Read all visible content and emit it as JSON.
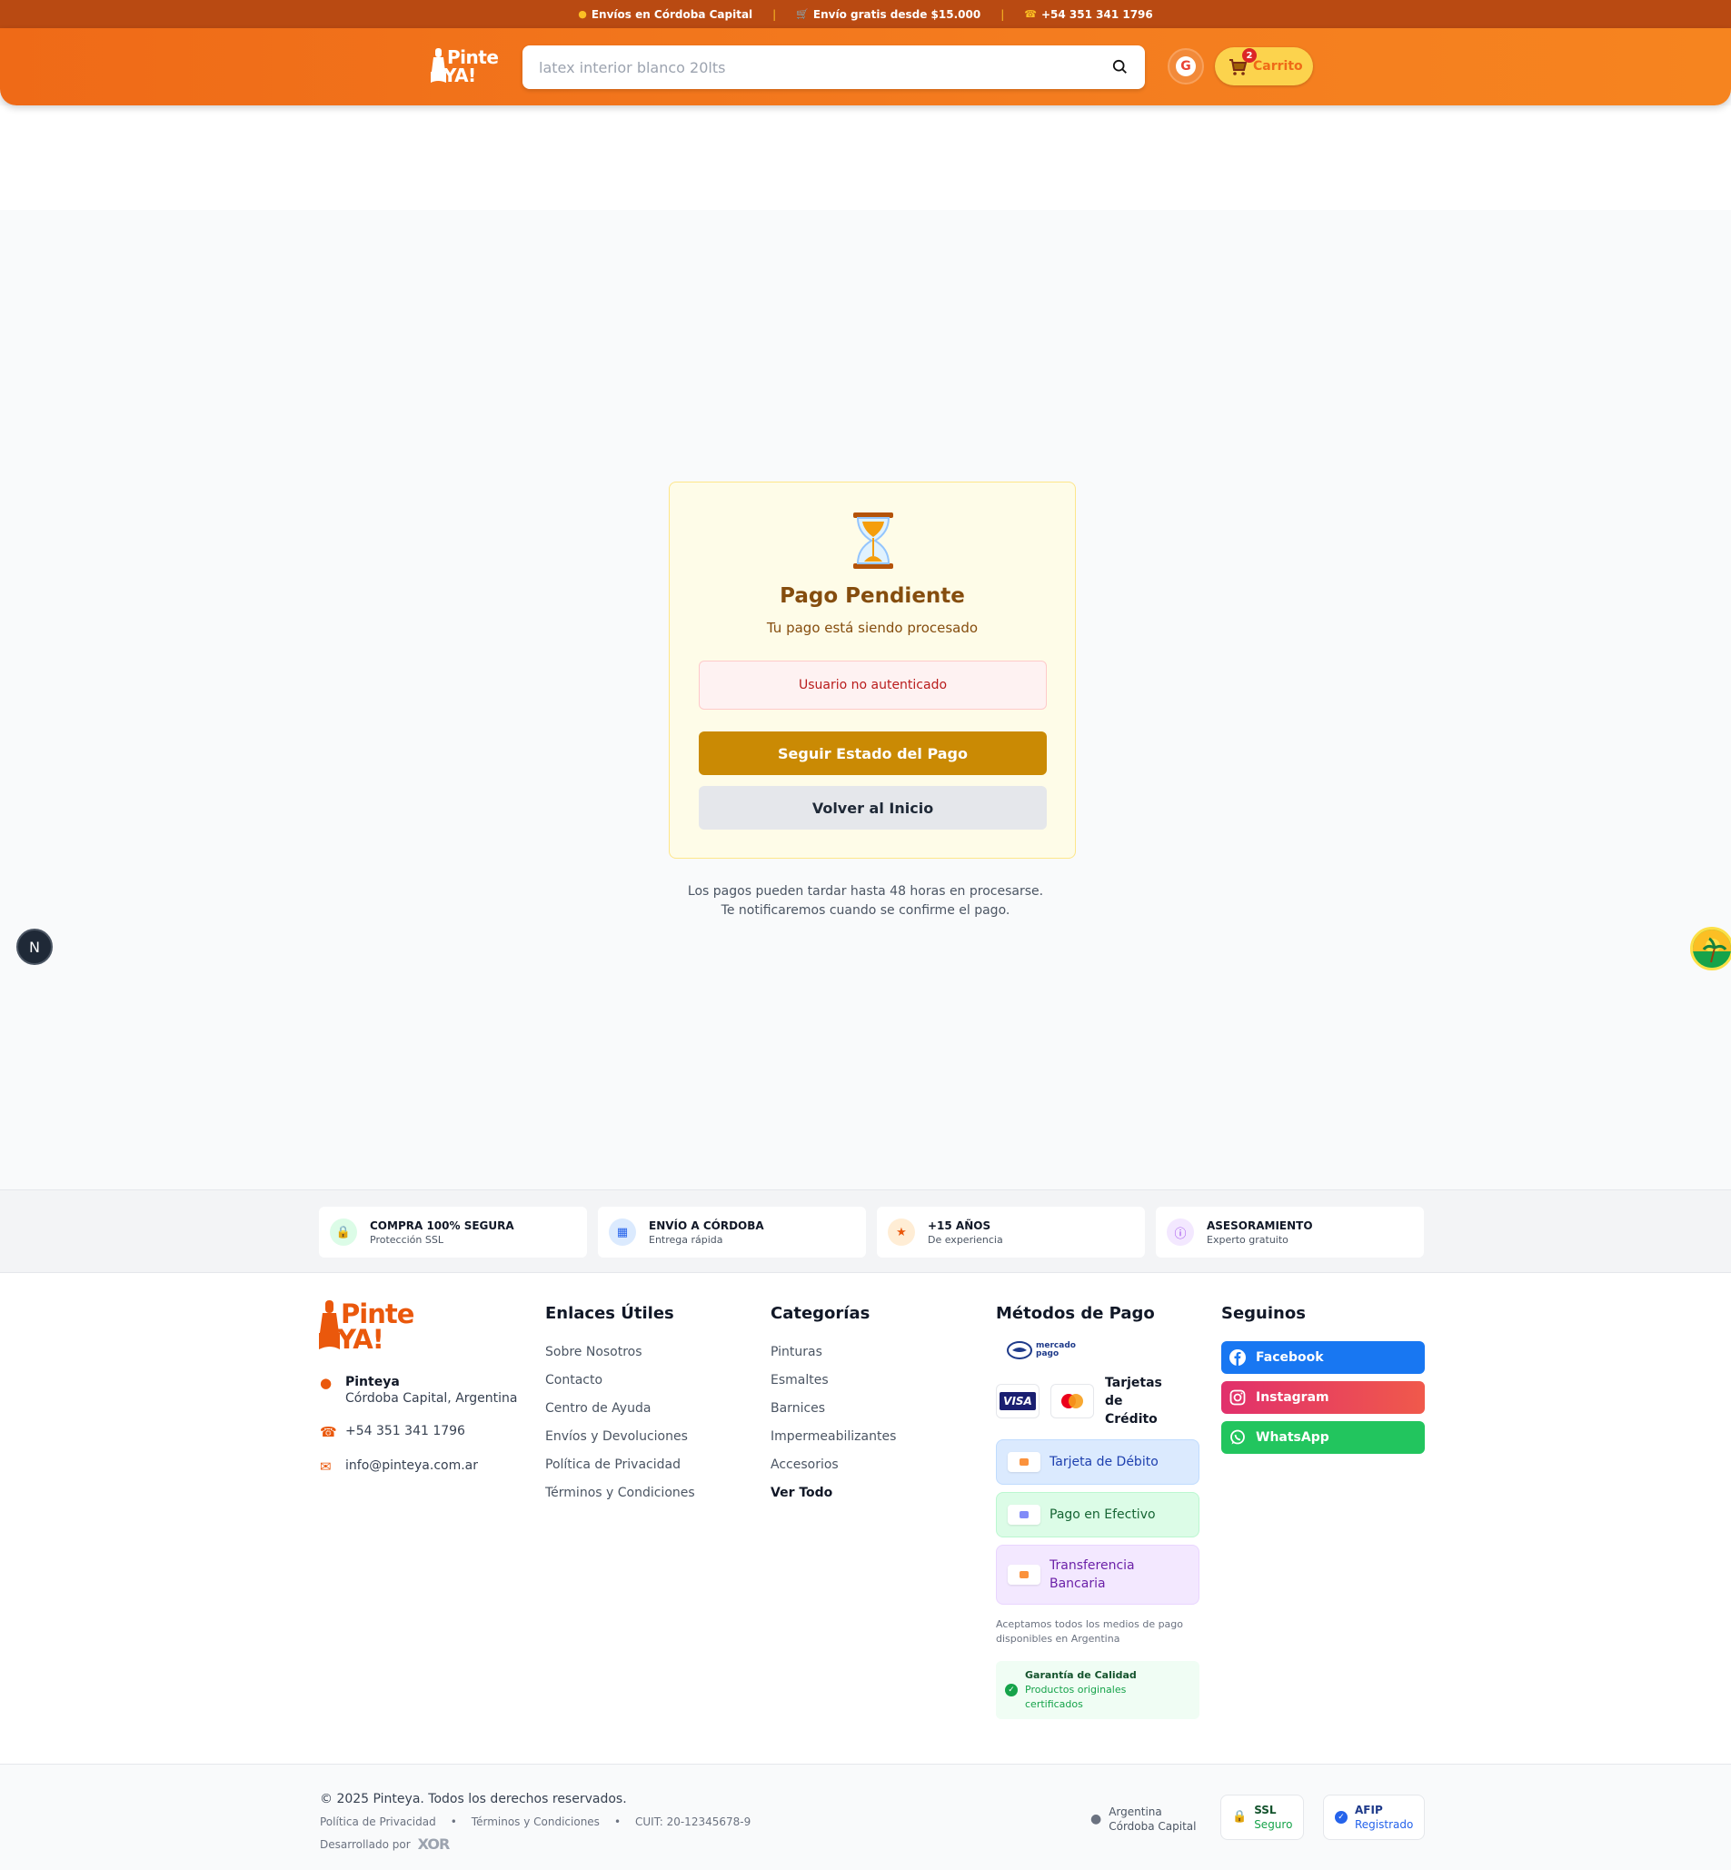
{
  "topbar": {
    "shipping": "Envíos en Córdoba Capital",
    "free_shipping": "Envío gratis desde $15.000",
    "phone": "+54 351 341 1796",
    "separator": "|"
  },
  "header": {
    "logo_line1": "Pinte",
    "logo_line2": "YA!",
    "search_placeholder": "latex interior blanco 20lts",
    "cart_label": "Carrito",
    "cart_count": "2"
  },
  "payment_status": {
    "title": "Pago Pendiente",
    "subtitle": "Tu pago está siendo procesado",
    "error": "Usuario no autenticado",
    "primary_button": "Seguir Estado del Pago",
    "secondary_button": "Volver al Inicio",
    "note_line1": "Los pagos pueden tardar hasta 48 horas en procesarse.",
    "note_line2": "Te notificaremos cuando se confirme el pago."
  },
  "floating": {
    "dev_badge": "N"
  },
  "trust": [
    {
      "title": "COMPRA 100% SEGURA",
      "subtitle": "Protección SSL",
      "icon": "lock-icon",
      "color": "#16a34a",
      "bg": "#dcfce7"
    },
    {
      "title": "ENVÍO A CÓRDOBA",
      "subtitle": "Entrega rápida",
      "icon": "truck-icon",
      "color": "#2563eb",
      "bg": "#dbeafe"
    },
    {
      "title": "+15 AÑOS",
      "subtitle": "De experiencia",
      "icon": "star-icon",
      "color": "#ea580c",
      "bg": "#ffedd5"
    },
    {
      "title": "ASESORAMIENTO",
      "subtitle": "Experto gratuito",
      "icon": "info-icon",
      "color": "#9333ea",
      "bg": "#f3e8ff"
    }
  ],
  "footer": {
    "logo_line1": "Pinte",
    "logo_line2": "YA!",
    "company": "Pinteya",
    "address": "Córdoba Capital, Argentina",
    "phone": "+54 351 341 1796",
    "email": "info@pinteya.com.ar",
    "useful_links": {
      "title": "Enlaces Útiles",
      "items": [
        "Sobre Nosotros",
        "Contacto",
        "Centro de Ayuda",
        "Envíos y Devoluciones",
        "Política de Privacidad",
        "Términos y Condiciones"
      ]
    },
    "categories": {
      "title": "Categorías",
      "items": [
        "Pinturas",
        "Esmaltes",
        "Barnices",
        "Impermeabilizantes",
        "Accesorios"
      ],
      "view_all": "Ver Todo"
    },
    "payment": {
      "title": "Métodos de Pago",
      "mercadopago_l1": "mercado",
      "mercadopago_l2": "pago",
      "visa": "VISA",
      "credit_cards": "Tarjetas de Crédito",
      "debit": "Tarjeta de Débito",
      "cash": "Pago en Efectivo",
      "transfer": "Transferencia Bancaria",
      "accept_note": "Aceptamos todos los medios de pago disponibles en Argentina",
      "guarantee_title": "Garantía de Calidad",
      "guarantee_text": "Productos originales certificados"
    },
    "social": {
      "title": "Seguinos",
      "facebook": "Facebook",
      "instagram": "Instagram",
      "whatsapp": "WhatsApp"
    }
  },
  "bottom": {
    "copyright": "© 2025 Pinteya. Todos los derechos reservados.",
    "privacy": "Política de Privacidad",
    "terms": "Términos y Condiciones",
    "cuit": "CUIT: 20-12345678-9",
    "bullet": "•",
    "developed_by": "Desarrollado por",
    "dev_logo": "XOR",
    "location_l1": "Argentina",
    "location_l2": "Córdoba Capital",
    "ssl_title": "SSL",
    "ssl_sub": "Seguro",
    "afip_title": "AFIP",
    "afip_sub": "Registrado"
  }
}
